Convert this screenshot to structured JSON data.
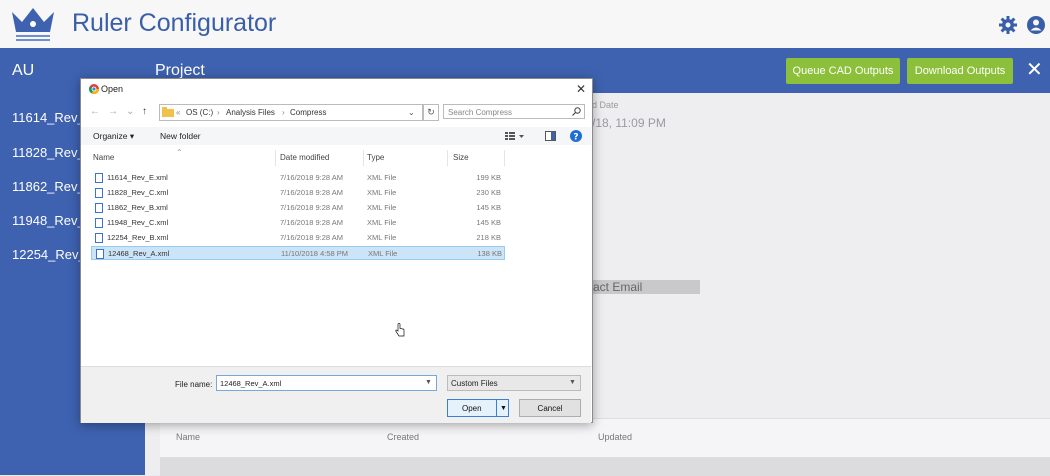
{
  "app": {
    "title": "Ruler Configurator"
  },
  "header": {
    "left_label": "AU",
    "project_label": "Project",
    "queue_button": "Queue CAD Outputs",
    "download_button": "Download Outputs",
    "close_glyph": "✕"
  },
  "sidebar": {
    "items": [
      "11614_Rev_E",
      "11828_Rev_C",
      "11862_Rev_B",
      "11948_Rev_C",
      "12254_Rev_B"
    ]
  },
  "background": {
    "date_label": "d Date",
    "date_value": "/18, 11:09 PM",
    "contact_label": "act Email",
    "table_headers": {
      "name": "Name",
      "created": "Created",
      "updated": "Updated"
    }
  },
  "dialog": {
    "title": "Open",
    "close_glyph": "✕",
    "nav": {
      "back": "←",
      "forward": "→",
      "recent": "⌄",
      "up": "↑"
    },
    "path": [
      "OS (C:)",
      "Analysis Files",
      "Compress"
    ],
    "path_sep": "›",
    "path_prefix": "«",
    "search_placeholder": "Search Compress",
    "toolbar": {
      "organize": "Organize ▾",
      "new_folder": "New folder"
    },
    "columns": {
      "name": "Name",
      "date": "Date modified",
      "type": "Type",
      "size": "Size"
    },
    "files": [
      {
        "name": "11614_Rev_E.xml",
        "date": "7/16/2018 9:28 AM",
        "type": "XML File",
        "size": "199 KB",
        "selected": false
      },
      {
        "name": "11828_Rev_C.xml",
        "date": "7/16/2018 9:28 AM",
        "type": "XML File",
        "size": "230 KB",
        "selected": false
      },
      {
        "name": "11862_Rev_B.xml",
        "date": "7/16/2018 9:28 AM",
        "type": "XML File",
        "size": "145 KB",
        "selected": false
      },
      {
        "name": "11948_Rev_C.xml",
        "date": "7/16/2018 9:28 AM",
        "type": "XML File",
        "size": "145 KB",
        "selected": false
      },
      {
        "name": "12254_Rev_B.xml",
        "date": "7/16/2018 9:28 AM",
        "type": "XML File",
        "size": "218 KB",
        "selected": false
      },
      {
        "name": "12468_Rev_A.xml",
        "date": "11/10/2018 4:58 PM",
        "type": "XML File",
        "size": "138 KB",
        "selected": true
      }
    ],
    "file_name_label": "File name:",
    "file_name_value": "12468_Rev_A.xml",
    "filter_value": "Custom Files",
    "open_button": "Open",
    "cancel_button": "Cancel"
  },
  "colors": {
    "brand_blue": "#3e62b0",
    "title_blue": "#3a5ea8",
    "green": "#8cbf3a",
    "selection": "#cce4f7"
  }
}
